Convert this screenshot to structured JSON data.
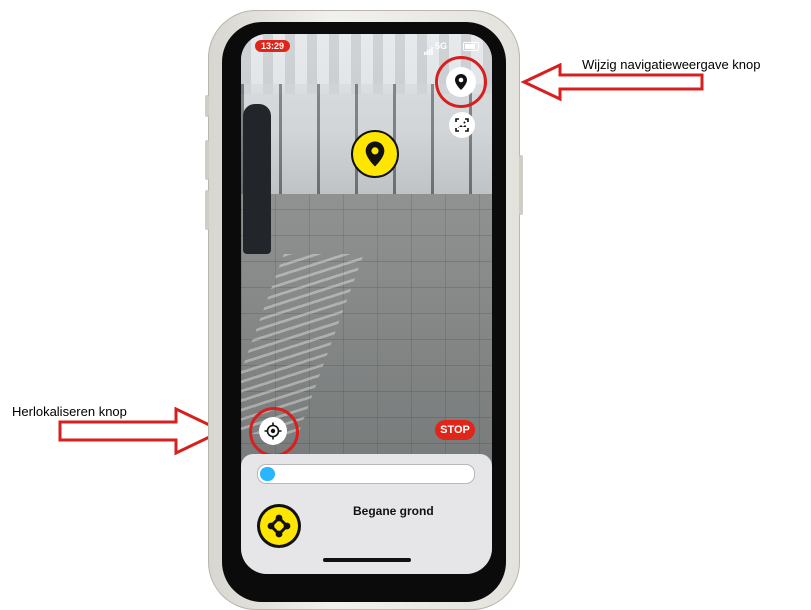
{
  "status_bar": {
    "time": "13:29",
    "network": "5G"
  },
  "annotations": {
    "nav_view_label": "Wijzig navigatieweergave knop",
    "relocalize_label": "Herlokaliseren knop"
  },
  "buttons": {
    "stop_label": "STOP"
  },
  "bottom_sheet": {
    "floor_name": "Begane grond",
    "progress_fraction": 0.07
  },
  "icons": {
    "nav_view": "map-pin-icon",
    "screenshot": "camera-frame-icon",
    "relocalize": "crosshair-icon",
    "destination": "map-pin-icon",
    "floor": "floor-nodes-icon"
  },
  "colors": {
    "accent_red": "#e0251b",
    "marker_yellow": "#ffe600",
    "progress_blue": "#29b6ff",
    "annotation_red": "#d81f1f"
  }
}
